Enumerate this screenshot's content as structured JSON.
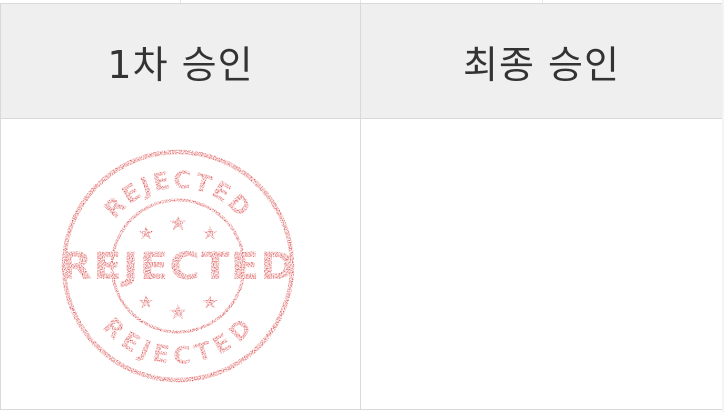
{
  "table": {
    "headers": {
      "first_approval": "1차 승인",
      "final_approval": "최종 승인"
    },
    "cells": {
      "first_approval_stamp": {
        "icon": "rejected-stamp-icon",
        "top_arc_text": "REJECTED",
        "center_text": "REJECTED",
        "bottom_arc_text": "REJECTED",
        "color": "#d42a2a"
      },
      "final_approval_value": ""
    }
  }
}
